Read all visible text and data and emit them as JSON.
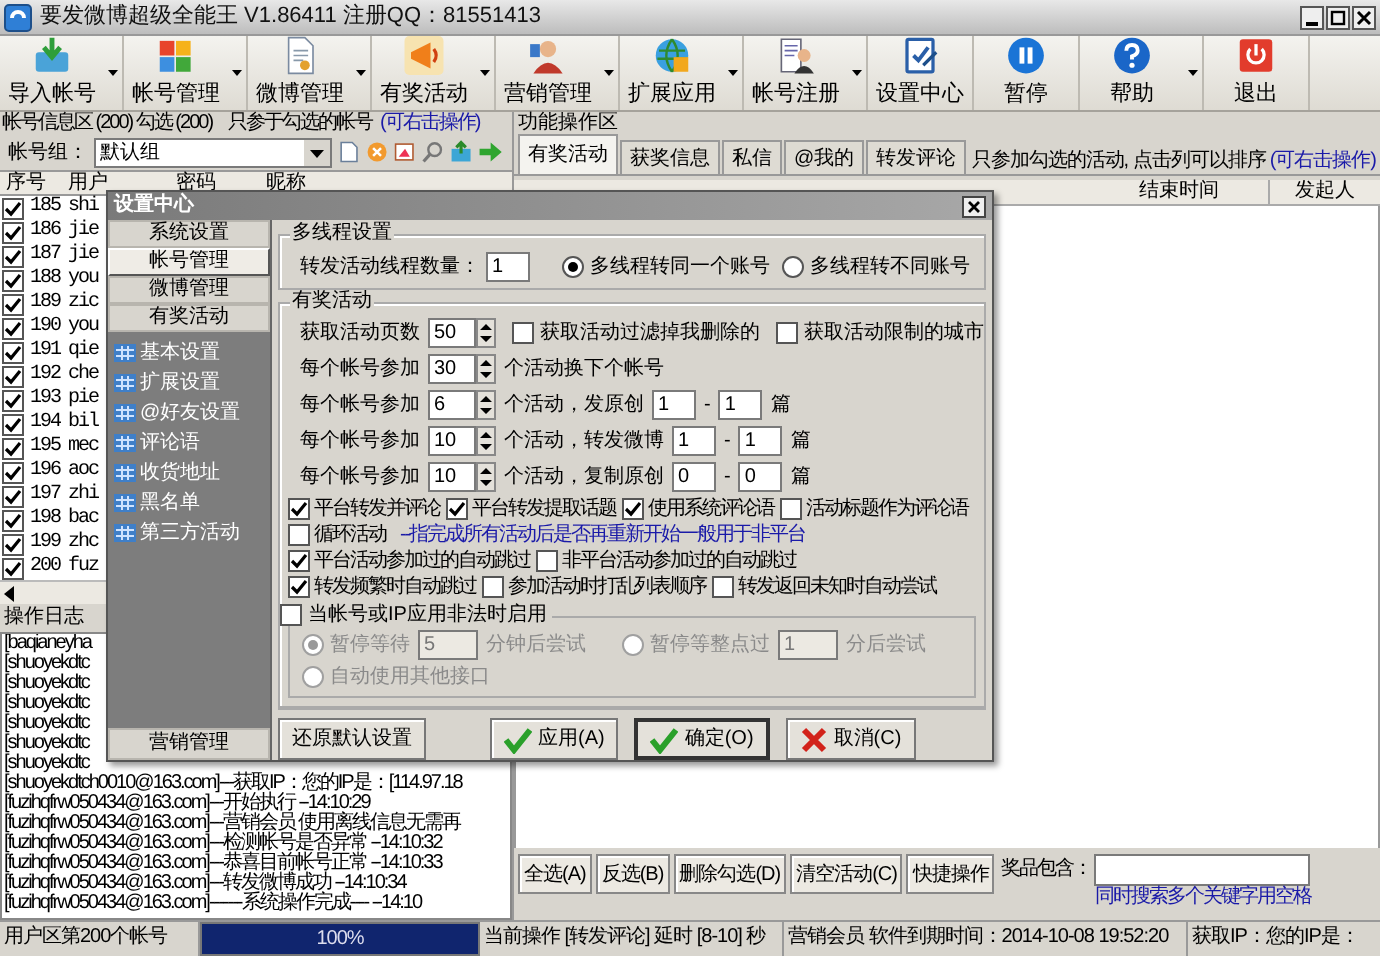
{
  "window": {
    "title": "要发微博超级全能王 V1.86411 注册QQ：81551413"
  },
  "toolbar": [
    {
      "label": "导入帐号",
      "dropdown": true
    },
    {
      "label": "帐号管理",
      "dropdown": true
    },
    {
      "label": "微博管理",
      "dropdown": true
    },
    {
      "label": "有奖活动",
      "dropdown": true
    },
    {
      "label": "营销管理",
      "dropdown": true
    },
    {
      "label": "扩展应用",
      "dropdown": true
    },
    {
      "label": "帐号注册",
      "dropdown": true
    },
    {
      "label": "设置中心",
      "dropdown": false
    },
    {
      "label": "暂停",
      "dropdown": false
    },
    {
      "label": "帮助",
      "dropdown": true
    },
    {
      "label": "退出",
      "dropdown": false
    }
  ],
  "account_panel": {
    "title": "帐号信息区 (200) 勾选 (200)",
    "note": "只参于勾选的帐号",
    "hint": "(可右击操作)",
    "group_label": "帐号组：",
    "group_value": "默认组",
    "columns": [
      "序号",
      "用户",
      "密码",
      "昵称"
    ],
    "rows": [
      {
        "checked": true,
        "no": "185",
        "user": "shi"
      },
      {
        "checked": true,
        "no": "186",
        "user": "jie"
      },
      {
        "checked": true,
        "no": "187",
        "user": "jie"
      },
      {
        "checked": true,
        "no": "188",
        "user": "you"
      },
      {
        "checked": true,
        "no": "189",
        "user": "zic"
      },
      {
        "checked": true,
        "no": "190",
        "user": "you"
      },
      {
        "checked": true,
        "no": "191",
        "user": "qie"
      },
      {
        "checked": true,
        "no": "192",
        "user": "che"
      },
      {
        "checked": true,
        "no": "193",
        "user": "pie"
      },
      {
        "checked": true,
        "no": "194",
        "user": "bil"
      },
      {
        "checked": true,
        "no": "195",
        "user": "mec"
      },
      {
        "checked": true,
        "no": "196",
        "user": "aoc"
      },
      {
        "checked": true,
        "no": "197",
        "user": "zhi"
      },
      {
        "checked": true,
        "no": "198",
        "user": "bac"
      },
      {
        "checked": true,
        "no": "199",
        "user": "zhc"
      },
      {
        "checked": true,
        "no": "200",
        "user": "fuz"
      }
    ]
  },
  "log": {
    "title": "操作日志",
    "lines": [
      "[baqianeyha",
      "[shuoyekdtc",
      "[shuoyekdtc",
      "[shuoyekdtc",
      "[shuoyekdtc",
      "[shuoyekdtc",
      "[shuoyekdtc",
      "[shuoyekdtch0010@163.com]---获取IP：您的IP是：[114.97.18",
      "[fuzihqfrw050434@163.com]---开始执行 --14:10:29",
      "[fuzihqfrw050434@163.com]---营销会员 使用离线信息无需再",
      "[fuzihqfrw050434@163.com]---检测帐号是否异常 --14:10:32",
      "[fuzihqfrw050434@163.com]---恭喜目前帐号正常 --14:10:33",
      "[fuzihqfrw050434@163.com]---转发微博成功 --14:10:34",
      "[fuzihqfrw050434@163.com]-------系统操作完成---- --14:10"
    ]
  },
  "function_panel": {
    "title": "功能操作区",
    "tabs": [
      {
        "label": "有奖活动",
        "selected": true
      },
      {
        "label": "获奖信息",
        "selected": false
      },
      {
        "label": "私信",
        "selected": false
      },
      {
        "label": "@我的",
        "selected": false
      },
      {
        "label": "转发评论",
        "selected": false
      }
    ],
    "note": "只参加勾选的活动, 点击列可以排序",
    "hint": "(可右击操作)",
    "columns": [
      "结束时间",
      "发起人"
    ],
    "buttons": [
      "全选(A)",
      "反选(B)",
      "删除勾选(D)",
      "清空活动(C)",
      "快捷操作"
    ],
    "prize_label": "奖品包含：",
    "prize_hint": "同时搜索多个关键字用空格"
  },
  "settings_dialog": {
    "title": "设置中心",
    "nav_buttons": [
      {
        "label": "系统设置",
        "selected": false
      },
      {
        "label": "帐号管理",
        "selected": true
      },
      {
        "label": "微博管理",
        "selected": false
      },
      {
        "label": "有奖活动",
        "selected": false
      }
    ],
    "nav_items": [
      "基本设置",
      "扩展设置",
      "@好友设置",
      "评论语",
      "收货地址",
      "黑名单",
      "第三方活动"
    ],
    "nav_footer": "营销管理",
    "thread_group": {
      "title": "多线程设置",
      "label": "转发活动线程数量：",
      "value": "1",
      "options": [
        {
          "label": "多线程转同一个账号",
          "selected": true
        },
        {
          "label": "多线程转不同账号",
          "selected": false
        }
      ]
    },
    "reward_group": {
      "title": "有奖活动",
      "pages": {
        "label": "获取活动页数",
        "value": "50"
      },
      "page_checks": [
        {
          "label": "获取活动过滤掉我删除的",
          "checked": false
        },
        {
          "label": "获取活动限制的城市",
          "checked": false
        }
      ],
      "quota_rows": [
        {
          "label": "每个帐号参加",
          "value": "30",
          "suffix": "个活动换下个帐号"
        },
        {
          "label": "每个帐号参加",
          "value": "6",
          "suffix": "个活动，发原创",
          "from": "1",
          "dash": "-",
          "to": "1",
          "unit": "篇"
        },
        {
          "label": "每个帐号参加",
          "value": "10",
          "suffix": "个活动，转发微博",
          "from": "1",
          "dash": "-",
          "to": "1",
          "unit": "篇"
        },
        {
          "label": "每个帐号参加",
          "value": "10",
          "suffix": "个活动，复制原创",
          "from": "0",
          "dash": "-",
          "to": "0",
          "unit": "篇"
        }
      ],
      "check_rows": [
        [
          {
            "kind": "checkbox",
            "label": "平台转发并评论",
            "checked": true
          },
          {
            "kind": "checkbox",
            "label": "平台转发提取话题",
            "checked": true
          },
          {
            "kind": "checkbox",
            "label": "使用系统评论语",
            "checked": true
          },
          {
            "kind": "checkbox",
            "label": "活动标题作为评论语",
            "checked": false
          }
        ],
        [
          {
            "kind": "checkbox",
            "label": "循环活动",
            "checked": false
          },
          {
            "kind": "hint",
            "text": "--指完成所有活动后是否再重新开始一般用于非平台"
          }
        ],
        [
          {
            "kind": "checkbox",
            "label": "平台活动参加过的自动跳过",
            "checked": true
          },
          {
            "kind": "checkbox",
            "label": "非平台活动参加过的自动跳过",
            "checked": false
          }
        ],
        [
          {
            "kind": "checkbox",
            "label": "转发频繁时自动跳过",
            "checked": true
          },
          {
            "kind": "checkbox",
            "label": "参加活动时打乱列表顺序",
            "checked": false
          },
          {
            "kind": "checkbox",
            "label": "转发返回未知时自动尝试",
            "checked": false
          }
        ]
      ],
      "fallback": {
        "label": "当帐号或IP应用非法时启用",
        "checked": false,
        "disabled": true,
        "option_rows": [
          [
            {
              "label": "暂停等待",
              "value": "5",
              "suffix": "分钟后尝试",
              "selected": true
            },
            {
              "label": "暂停等整点过",
              "value": "1",
              "suffix": "分后尝试",
              "selected": false
            }
          ],
          [
            {
              "label": "自动使用其他接口",
              "selected": false
            }
          ]
        ]
      }
    },
    "buttons": [
      {
        "label": "还原默认设置",
        "kind": "reset"
      },
      {
        "label": "应用(A)",
        "kind": "apply"
      },
      {
        "label": "确定(O)",
        "kind": "ok"
      },
      {
        "label": "取消(C)",
        "kind": "cancel"
      }
    ]
  },
  "status_bar": {
    "account": "用户区第200个帐号",
    "progress": {
      "level": 1,
      "label": "100%"
    },
    "operation": "当前操作 [转发评论] 延时 [8-10] 秒",
    "member": "营销会员 软件到期时间：2014-10-08 19:52:20",
    "ip": "获取IP：您的IP是："
  }
}
